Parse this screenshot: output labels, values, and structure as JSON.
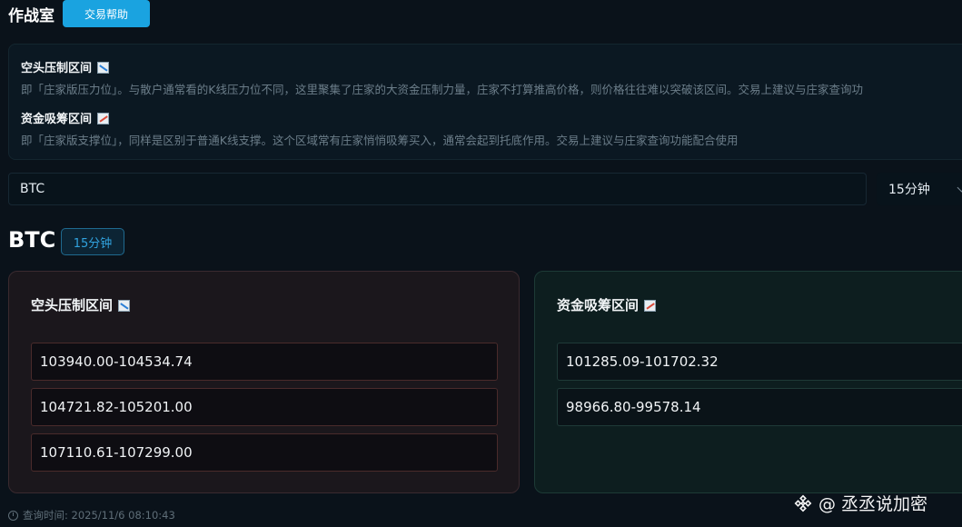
{
  "header": {
    "title": "作战室",
    "help_label": "交易帮助"
  },
  "info": {
    "short_title": "空头压制区间",
    "short_desc": "即「庄家版压力位」。与散户通常看的K线压力位不同，这里聚集了庄家的大资金压制力量，庄家不打算推高价格，则价格往往难以突破该区间。交易上建议与庄家查询功",
    "long_title": "资金吸筹区间",
    "long_desc": "即「庄家版支撑位」，同样是区别于普通K线支撑。这个区域常有庄家悄悄吸筹买入，通常会起到托底作用。交易上建议与庄家查询功能配合使用",
    "short_icon": "chart-decreasing-icon",
    "long_icon": "chart-increasing-icon"
  },
  "search": {
    "value": "BTC"
  },
  "interval": {
    "selected": "15分钟"
  },
  "result": {
    "symbol": "BTC",
    "interval_badge": "15分钟"
  },
  "short_card": {
    "title": "空头压制区间",
    "ranges": [
      "103940.00-104534.74",
      "104721.82-105201.00",
      "107110.61-107299.00"
    ]
  },
  "long_card": {
    "title": "资金吸筹区间",
    "ranges": [
      "101285.09-101702.32",
      "98966.80-99578.14"
    ]
  },
  "footer": {
    "query_time": "查询时间: 2025/11/6 08:10:43"
  },
  "watermark": {
    "text": "@ 丞丞说加密"
  },
  "colors": {
    "accent": "#1aa3e0",
    "short_bg": "#1b171c",
    "long_bg": "#0d1e1f",
    "page_bg": "#0a121a"
  }
}
